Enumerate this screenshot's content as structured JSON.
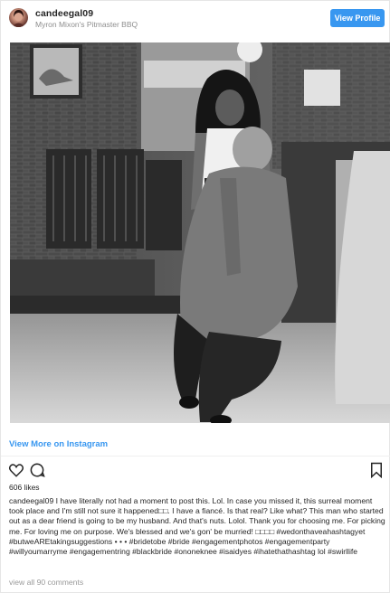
{
  "header": {
    "username": "candeegal09",
    "location": "Myron Mixon's Pitmaster BBQ",
    "view_profile_label": "View Profile"
  },
  "post": {
    "view_more_label": "View More on Instagram",
    "likes_text": "606 likes",
    "caption_username": "candeegal09",
    "caption_text": "I have literally not had a moment to post this. Lol. In case you missed it, this surreal moment took place and I'm still not sure it happened□□. I have a fiancé. Is that real? Like what? This man who started out as a dear friend is going to be my husband. And that's nuts. Lolol. Thank you for choosing me. For picking me. For loving me on purpose. We's blessed and we's gon' be murried! □□□□ #wedonthaveahashtagyet #butweAREtakingsuggestions • • • #bridetobe #bride #engagementphotos #engagementparty #willyoumarryme #engagementring #blackbride #ononeknee #isaidyes #ihatethathashtag lol #swirllife",
    "view_comments_label": "view all 90 comments"
  },
  "icons": {
    "like": "heart-icon",
    "comment": "comment-bubble-icon",
    "save": "bookmark-icon"
  },
  "colors": {
    "accent": "#3897f0",
    "text": "#262626",
    "muted": "#999999"
  }
}
